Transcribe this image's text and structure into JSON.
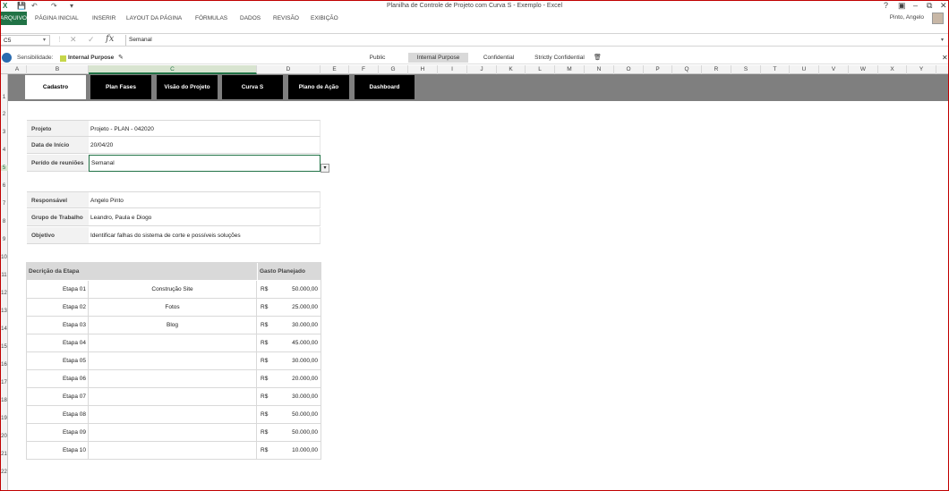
{
  "window": {
    "title": "Planilha de Controle de Projeto com Curva S - Exemplo - Excel",
    "user": "Pinto, Angelo"
  },
  "ribbon": {
    "tabs": [
      "ARQUIVO",
      "PÁGINA INICIAL",
      "INSERIR",
      "LAYOUT DA PÁGINA",
      "FÓRMULAS",
      "DADOS",
      "REVISÃO",
      "EXIBIÇÃO"
    ]
  },
  "formula_bar": {
    "name_box": "C5",
    "content": "Semanal"
  },
  "sensitivity": {
    "label": "Sensibilidade:",
    "current": "Internal Purpose",
    "options": [
      "Public",
      "Internal Purpose",
      "Confidential",
      "Strictly Confidential"
    ],
    "selected_option": "Internal Purpose",
    "current_color": "#c6d64a"
  },
  "columns": [
    "A",
    "B",
    "C",
    "D",
    "E",
    "F",
    "G",
    "H",
    "I",
    "J",
    "K",
    "L",
    "M",
    "N",
    "O",
    "P",
    "Q",
    "R",
    "S",
    "T",
    "U",
    "V",
    "W",
    "X",
    "Y"
  ],
  "rows": [
    "1",
    "2",
    "3",
    "4",
    "5",
    "6",
    "7",
    "8",
    "9",
    "10",
    "11",
    "12",
    "13",
    "14",
    "15",
    "16",
    "17",
    "18",
    "19",
    "20",
    "21",
    "22"
  ],
  "nav": {
    "buttons": [
      "Cadastro",
      "Plan Fases",
      "Visão do Projeto",
      "Curva S",
      "Plano de Ação",
      "Dashboard"
    ],
    "active": "Cadastro"
  },
  "project": {
    "projeto_label": "Projeto",
    "projeto_value": "Projeto - PLAN - 042020",
    "data_label": "Data de Início",
    "data_value": "20/04/20",
    "periodo_label": "Perído de reuniões",
    "periodo_value": "Semanal"
  },
  "team": {
    "responsavel_label": "Responsável",
    "responsavel_value": "Angelo Pinto",
    "grupo_label": "Grupo de Trabalho",
    "grupo_value": "Leandro, Paula e Diogo",
    "objetivo_label": "Objetivo",
    "objetivo_value": "Identificar falhas do sistema de corte e possíveis soluções"
  },
  "stages": {
    "header_desc": "Decrição da Etapa",
    "header_cost": "Gasto Planejado",
    "currency": "R$",
    "rows": [
      {
        "etapa": "Etapa 01",
        "desc": "Construção Site",
        "valor": "50.000,00"
      },
      {
        "etapa": "Etapa 02",
        "desc": "Fotos",
        "valor": "25.000,00"
      },
      {
        "etapa": "Etapa 03",
        "desc": "Blog",
        "valor": "30.000,00"
      },
      {
        "etapa": "Etapa 04",
        "desc": "",
        "valor": "45.000,00"
      },
      {
        "etapa": "Etapa 05",
        "desc": "",
        "valor": "30.000,00"
      },
      {
        "etapa": "Etapa 06",
        "desc": "",
        "valor": "20.000,00"
      },
      {
        "etapa": "Etapa 07",
        "desc": "",
        "valor": "30.000,00"
      },
      {
        "etapa": "Etapa 08",
        "desc": "",
        "valor": "50.000,00"
      },
      {
        "etapa": "Etapa 09",
        "desc": "",
        "valor": "50.000,00"
      },
      {
        "etapa": "Etapa 10",
        "desc": "",
        "valor": "10.000,00"
      }
    ]
  }
}
